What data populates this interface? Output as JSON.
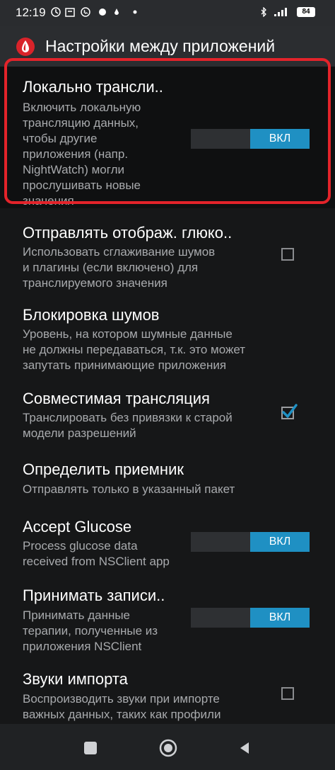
{
  "status_bar": {
    "time": "12:19",
    "battery": "84"
  },
  "header": {
    "title": "Настройки между приложений"
  },
  "settings": [
    {
      "title": "Локально трансли..",
      "summary": "Включить локальную\nтрансляцию данных,\nчтобы другие\nприложения (напр.\nNightWatch) могли\nпрослушивать новые\nзначения",
      "control": "toggle",
      "toggle_label": "ВКЛ"
    },
    {
      "title": "Отправлять отображ. глюко..",
      "summary": "Использовать сглаживание шумов\nи плагины (если включено) для\nтранслируемого значения",
      "control": "checkbox",
      "checked": false
    },
    {
      "title": "Блокировка шумов",
      "summary": "Уровень, на котором шумные данные\nне должны передаваться, т.к. это может\nзапутать принимающие приложения",
      "control": "none"
    },
    {
      "title": "Совместимая трансляция",
      "summary": "Транслировать без привязки к старой\nмодели разрешений",
      "control": "checkbox",
      "checked": true
    },
    {
      "title": "Определить приемник",
      "summary": "Отправлять только в указанный пакет",
      "control": "none"
    },
    {
      "title": "Accept Glucose",
      "summary": "Process glucose data\nreceived from NSClient app",
      "control": "toggle",
      "toggle_label": "ВКЛ"
    },
    {
      "title": "Принимать записи..",
      "summary": "Принимать данные\nтерапии, полученные из\nприложения NSClient",
      "control": "toggle",
      "toggle_label": "ВКЛ"
    },
    {
      "title": "Звуки импорта",
      "summary": "Воспроизводить звуки при импорте\nважных данных, таких как профили",
      "control": "checkbox",
      "checked": false
    }
  ],
  "colors": {
    "accent": "#1f90c3",
    "highlight": "#e3232a"
  }
}
